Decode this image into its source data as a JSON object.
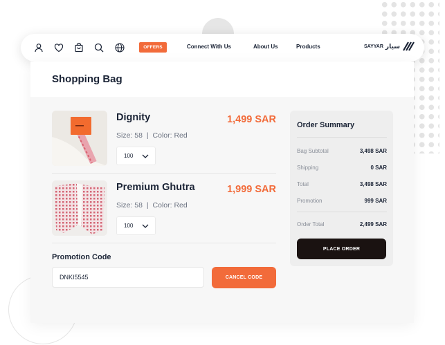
{
  "nav": {
    "icons": [
      "user-icon",
      "heart-icon",
      "bag-icon",
      "search-icon",
      "globe-icon"
    ],
    "offers_label": "OFFERS",
    "links": [
      "Connect With Us",
      "About Us",
      "Products"
    ],
    "brand_text": "SAYYAR",
    "brand_arabic": "سيار"
  },
  "page": {
    "title": "Shopping Bag"
  },
  "items": [
    {
      "name": "Dignity",
      "price": "1,499 SAR",
      "size_label": "Size:",
      "size": "58",
      "color_label": "Color:",
      "color": "Red",
      "qty": "100"
    },
    {
      "name": "Premium Ghutra",
      "price": "1,999 SAR",
      "size_label": "Size:",
      "size": "58",
      "color_label": "Color:",
      "color": "Red",
      "qty": "100"
    }
  ],
  "promo": {
    "label": "Promotion Code",
    "value": "DNKI5545",
    "cancel_label": "CANCEL CODE"
  },
  "summary": {
    "title": "Order Summary",
    "rows": [
      {
        "label": "Bag Subtotal",
        "value": "3,498 SAR"
      },
      {
        "label": "Shipping",
        "value": "0 SAR"
      },
      {
        "label": "Total",
        "value": "3,498 SAR"
      },
      {
        "label": "Promotion",
        "value": "999 SAR"
      }
    ],
    "order_total": {
      "label": "Order Total",
      "value": "2,499 SAR"
    },
    "place_order_label": "PLACE ORDER"
  },
  "colors": {
    "accent": "#f26b3a",
    "dark": "#1a1211",
    "text": "#1b2436"
  }
}
